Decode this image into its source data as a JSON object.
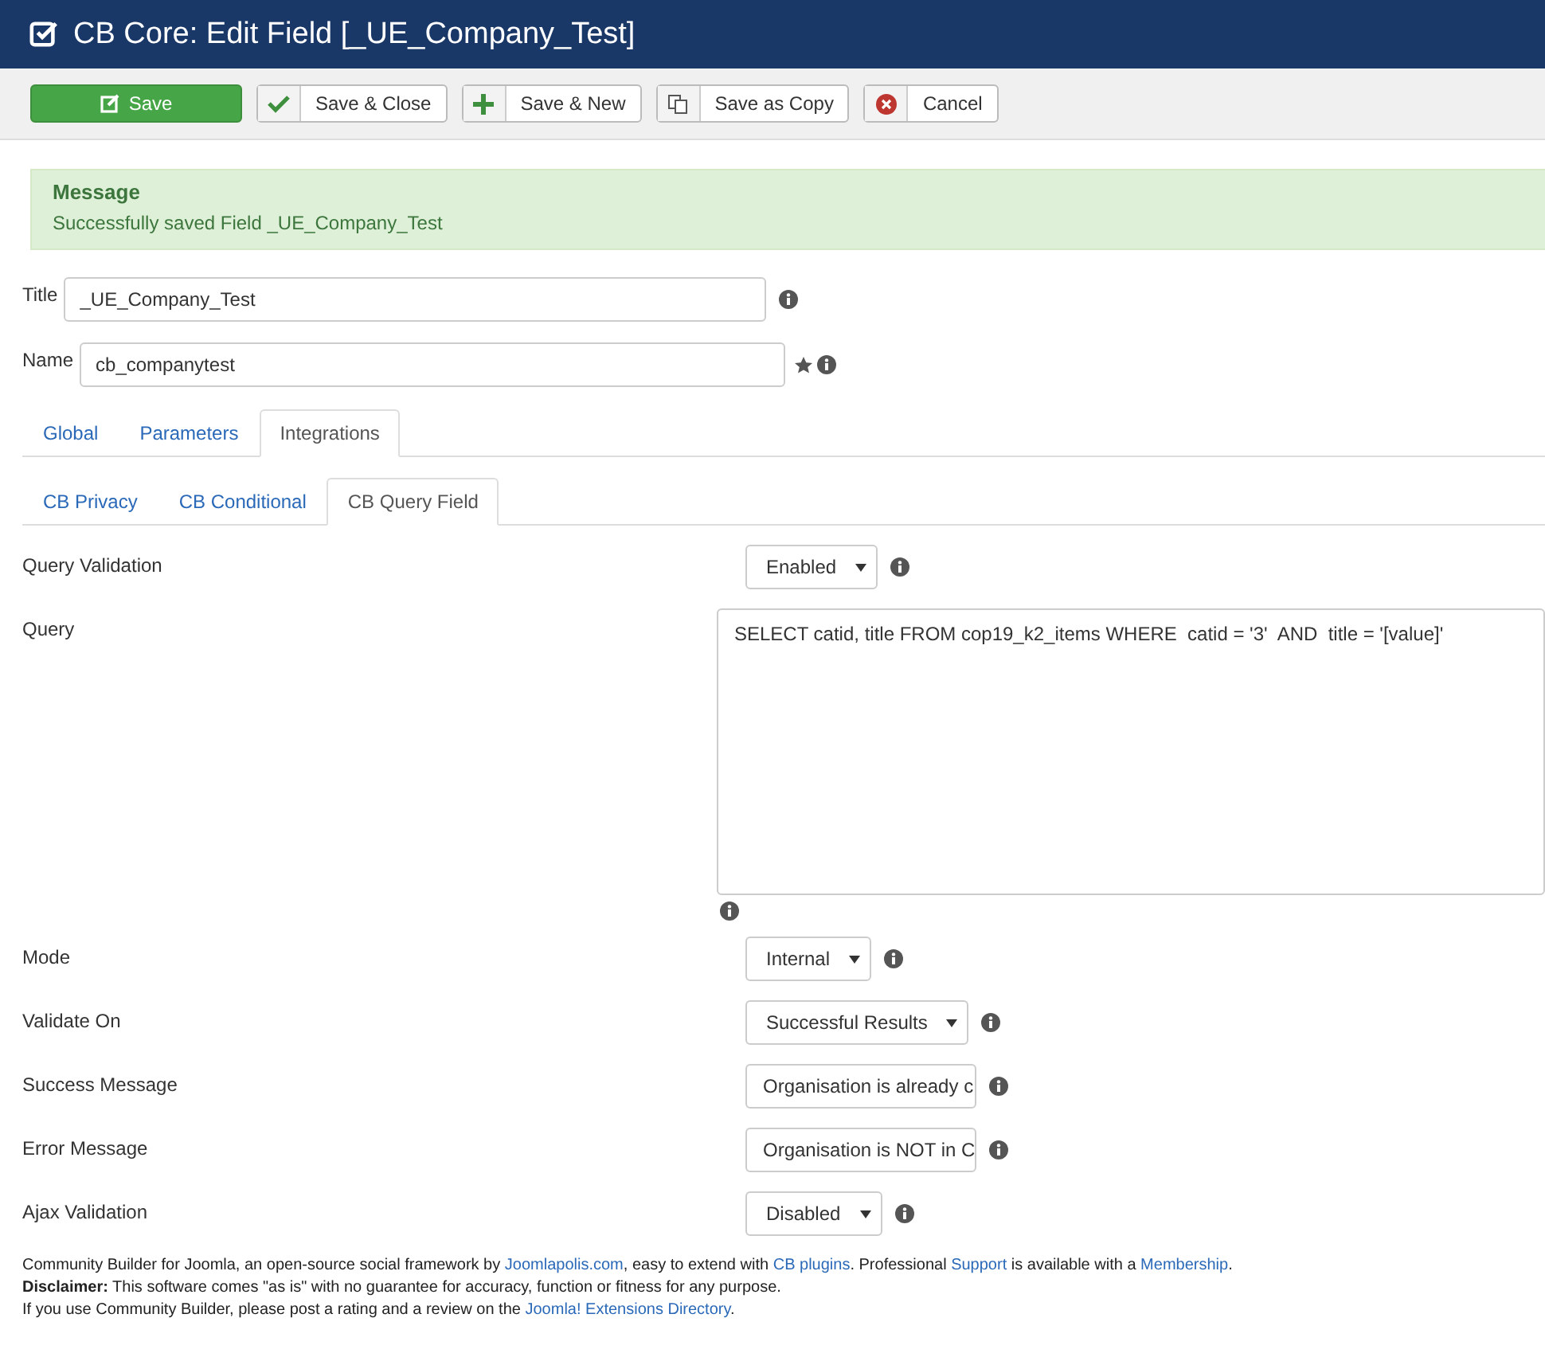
{
  "header": {
    "title": "CB Core: Edit Field [_UE_Company_Test]"
  },
  "toolbar": [
    {
      "kind": "primary",
      "label": "Save"
    },
    {
      "kind": "default",
      "label": "Save & Close"
    },
    {
      "kind": "default",
      "label": "Save & New"
    },
    {
      "kind": "default",
      "label": "Save as Copy"
    },
    {
      "kind": "default",
      "label": "Cancel"
    }
  ],
  "message": {
    "heading": "Message",
    "text": "Successfully saved Field _UE_Company_Test"
  },
  "title_field": {
    "label": "Title",
    "value": "_UE_Company_Test"
  },
  "name_field": {
    "label": "Name",
    "value": "cb_companytest"
  },
  "tabs": [
    {
      "label": "Global",
      "selected": false
    },
    {
      "label": "Parameters",
      "selected": false
    },
    {
      "label": "Integrations",
      "selected": true
    }
  ],
  "subtabs": [
    {
      "label": "CB Privacy",
      "selected": false
    },
    {
      "label": "CB Conditional",
      "selected": false
    },
    {
      "label": "CB Query Field",
      "selected": true
    }
  ],
  "fields": [
    {
      "label": "Query Validation",
      "kind": "select",
      "value": "Enabled"
    },
    {
      "label": "Query",
      "kind": "textarea",
      "value": "SELECT catid, title FROM cop19_k2_items WHERE  catid = '3'  AND  title = '[value]'"
    },
    {
      "label": "Mode",
      "kind": "select",
      "value": "Internal"
    },
    {
      "label": "Validate On",
      "kind": "select",
      "value": "Successful Results"
    },
    {
      "label": "Success Message",
      "kind": "input",
      "value": "Organisation is already c"
    },
    {
      "label": "Error Message",
      "kind": "input",
      "value": "Organisation is NOT in C"
    },
    {
      "label": "Ajax Validation",
      "kind": "select",
      "value": "Disabled"
    }
  ],
  "footer": [
    [
      {
        "kind": "text",
        "text": "Community Builder for Joomla, an open-source social framework by "
      },
      {
        "kind": "link",
        "text": "Joomlapolis.com"
      },
      {
        "kind": "text",
        "text": ", easy to extend with "
      },
      {
        "kind": "link",
        "text": "CB plugins"
      },
      {
        "kind": "text",
        "text": ". Professional "
      },
      {
        "kind": "link",
        "text": "Support"
      },
      {
        "kind": "text",
        "text": " is available with a "
      },
      {
        "kind": "link",
        "text": "Membership"
      },
      {
        "kind": "text",
        "text": "."
      }
    ],
    [
      {
        "kind": "text",
        "text": "**Disclaimer:** This software comes \"as is\" with no guarantee for accuracy, function or fitness for any purpose."
      }
    ],
    [
      {
        "kind": "text",
        "text": "If you use Community Builder, please post a rating and a review on the "
      },
      {
        "kind": "link",
        "text": "Joomla! Extensions Directory"
      },
      {
        "kind": "text",
        "text": "."
      }
    ]
  ]
}
